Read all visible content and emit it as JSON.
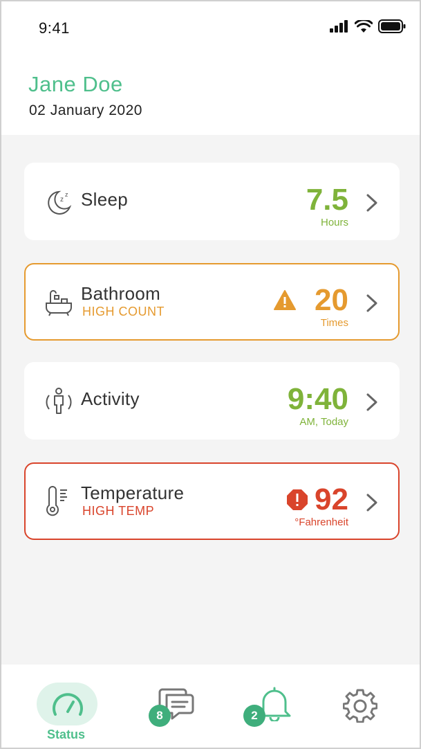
{
  "status_bar": {
    "time": "9:41"
  },
  "header": {
    "name": "Jane Doe",
    "date": "02 January 2020"
  },
  "cards": [
    {
      "title": "Sleep",
      "subtitle": "",
      "value": "7.5",
      "unit": "Hours",
      "state": "normal",
      "color": "#7fb33a",
      "icon": "moon-sleep-icon"
    },
    {
      "title": "Bathroom",
      "subtitle": "HIGH COUNT",
      "value": "20",
      "unit": "Times",
      "state": "warning",
      "color": "#e59a2f",
      "icon": "bathtub-icon"
    },
    {
      "title": "Activity",
      "subtitle": "",
      "value": "9:40",
      "unit": "AM, Today",
      "state": "normal",
      "color": "#7fb33a",
      "icon": "person-activity-icon"
    },
    {
      "title": "Temperature",
      "subtitle": "HIGH TEMP",
      "value": "92",
      "unit": "°Fahrenheit",
      "state": "alert",
      "color": "#d9442b",
      "icon": "thermometer-icon"
    }
  ],
  "nav": {
    "status_label": "Status",
    "messages_badge": "8",
    "alerts_badge": "2"
  },
  "colors": {
    "brand_green": "#4fbf8c",
    "value_green": "#7fb33a",
    "warning": "#e59a2f",
    "alert": "#d9442b"
  }
}
